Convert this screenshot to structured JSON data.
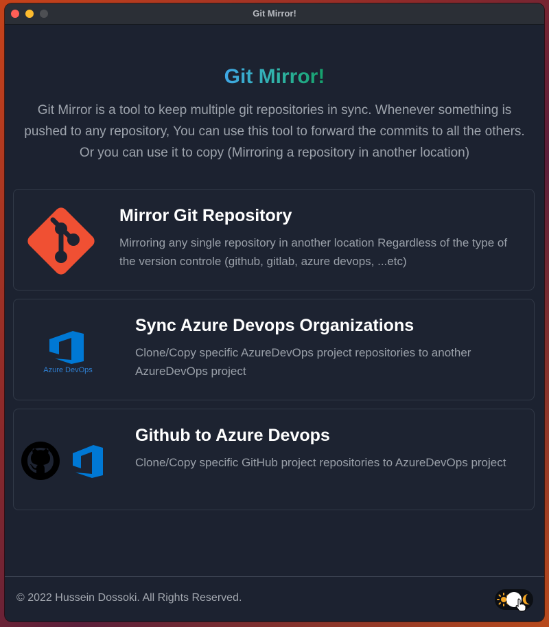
{
  "window": {
    "title": "Git Mirror!"
  },
  "header": {
    "title": "Git Mirror!",
    "intro": "Git Mirror is a tool to keep multiple git repositories in sync. Whenever something is pushed to any repository, You can use this tool to forward the commits to all the others. Or you can use it to copy (Mirroring a repository in another location)"
  },
  "cards": [
    {
      "title": "Mirror Git Repository",
      "description": "Mirroring any single repository in another location Regardless of the type of the version controle (github, gitlab, azure devops, ...etc)",
      "icon": "git-logo-icon"
    },
    {
      "title": "Sync Azure Devops Organizations",
      "description": "Clone/Copy specific AzureDevOps project repositories to another AzureDevOps project",
      "icon": "azure-devops-logo-icon",
      "logo_caption": "Azure DevOps"
    },
    {
      "title": "Github to Azure Devops",
      "description": "Clone/Copy specific GitHub project repositories to AzureDevOps project",
      "icons": [
        "github-logo-icon",
        "azure-devops-logo-icon"
      ]
    }
  ],
  "footer": {
    "copyright": "© 2022 Hussein Dossoki. All Rights Reserved.",
    "theme_toggle": {
      "icons": [
        "sun-icon",
        "moon-icon",
        "pointer-hand-icon"
      ]
    }
  },
  "colors": {
    "background": "#1c2230",
    "card_border": "#323a48",
    "title_gradient_start": "#3fa7e6",
    "title_gradient_end": "#15a06a",
    "git_orange": "#f05033",
    "azure_blue": "#0078d4"
  }
}
